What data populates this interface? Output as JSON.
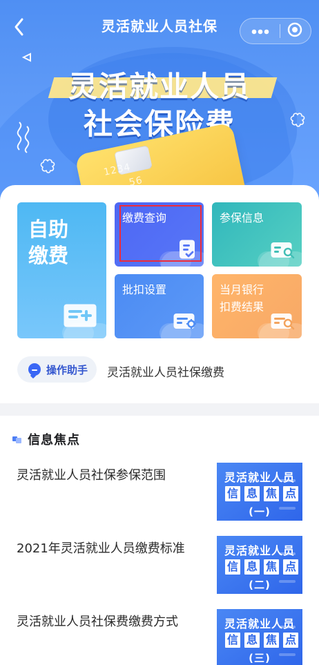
{
  "nav": {
    "title": "灵活就业人员社保"
  },
  "hero": {
    "line1": "灵活就业人员",
    "line2": "社会保险费",
    "card_num_1": "1234",
    "card_num_2": "56"
  },
  "tiles": {
    "self_payment": "自助\n缴费",
    "payment_query": "缴费查询",
    "insured_info": "参保信息",
    "withholding_settings": "批扣设置",
    "bank_result": "当月银行\n扣费结果"
  },
  "assistant": {
    "button_label": "操作助手",
    "text": "灵活就业人员社保缴费"
  },
  "info": {
    "title": "信息焦点"
  },
  "news": [
    {
      "title": "灵活就业人员社保参保范围",
      "thumb_title": "灵活就业人员",
      "chars": [
        "信",
        "息",
        "焦",
        "点"
      ],
      "tag": "(一)"
    },
    {
      "title": "2021年灵活就业人员缴费标准",
      "thumb_title": "灵活就业人员",
      "chars": [
        "信",
        "息",
        "焦",
        "点"
      ],
      "tag": "(二)"
    },
    {
      "title": "灵活就业人员社保费缴费方式",
      "thumb_title": "灵活就业人员",
      "chars": [
        "信",
        "息",
        "焦",
        "点"
      ],
      "tag": "(三)"
    }
  ],
  "icons": {
    "back": "chevron-left-icon",
    "more": "more-dots-icon",
    "target": "target-icon",
    "assistant": "chat-bubble-icon",
    "info": "info-bullet-icon"
  },
  "colors": {
    "primary": "#4e8ff3",
    "highlight": "#ef2b39",
    "assistant_text": "#3457cf"
  }
}
